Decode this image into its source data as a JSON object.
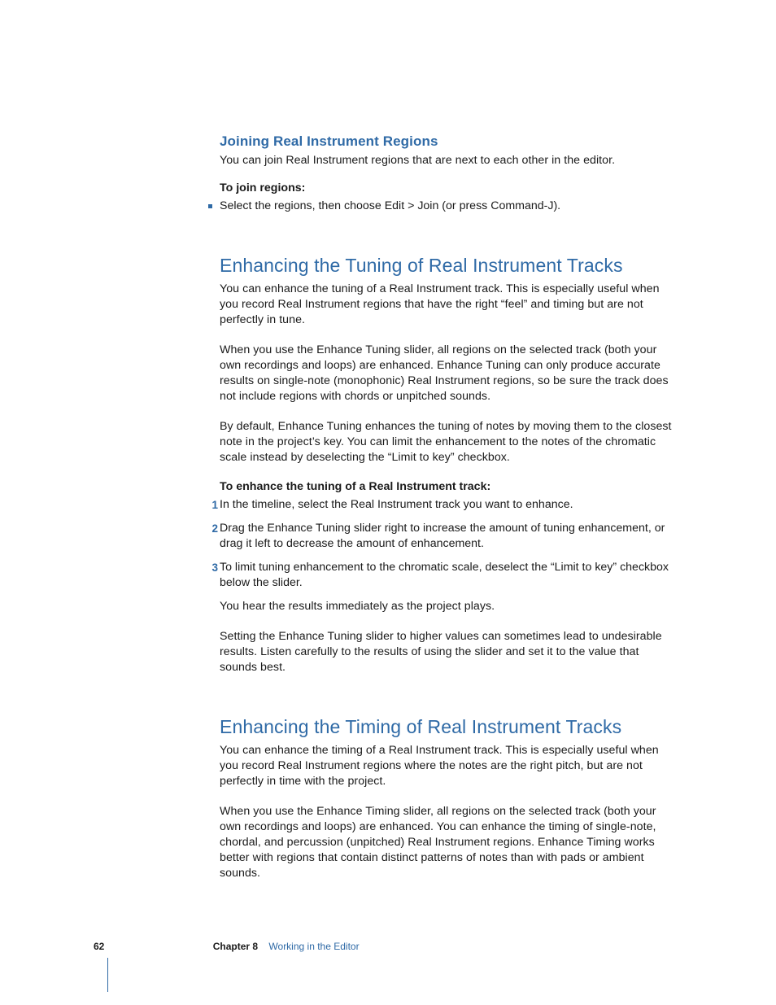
{
  "s1": {
    "h": "Joining Real Instrument Regions",
    "p1": "You can join Real Instrument regions that are next to each other in the editor.",
    "lead": "To join regions:",
    "b1": "Select the regions, then choose Edit > Join (or press Command-J)."
  },
  "s2": {
    "h": "Enhancing the Tuning of Real Instrument Tracks",
    "p1": "You can enhance the tuning of a Real Instrument track. This is especially useful when you record Real Instrument regions that have the right “feel” and timing but are not perfectly in tune.",
    "p2": "When you use the Enhance Tuning slider, all regions on the selected track (both your own recordings and loops) are enhanced. Enhance Tuning can only produce accurate results on single-note (monophonic) Real Instrument regions, so be sure the track does not include regions with chords or unpitched sounds.",
    "p3": "By default, Enhance Tuning enhances the tuning of notes by moving them to the closest note in the project’s key. You can limit the enhancement to the notes of the chromatic scale instead by deselecting the “Limit to key” checkbox.",
    "lead": "To enhance the tuning of a Real Instrument track:",
    "st1": "In the timeline, select the Real Instrument track you want to enhance.",
    "st2": "Drag the Enhance Tuning slider right to increase the amount of tuning enhancement, or drag it left to decrease the amount of enhancement.",
    "st3": "To limit tuning enhancement to the chromatic scale, deselect the “Limit to key” checkbox below the slider.",
    "p4": "You hear the results immediately as the project plays.",
    "p5": "Setting the Enhance Tuning slider to higher values can sometimes lead to undesirable results. Listen carefully to the results of using the slider and set it to the value that sounds best."
  },
  "s3": {
    "h": "Enhancing the Timing of Real Instrument Tracks",
    "p1": "You can enhance the timing of a Real Instrument track. This is especially useful when you record Real Instrument regions where the notes are the right pitch, but are not perfectly in time with the project.",
    "p2": "When you use the Enhance Timing slider, all regions on the selected track (both your own recordings and loops) are enhanced. You can enhance the timing of single-note, chordal, and percussion (unpitched) Real Instrument regions. Enhance Timing works better with regions that contain distinct patterns of notes than with pads or ambient sounds."
  },
  "nums": {
    "n1": "1",
    "n2": "2",
    "n3": "3"
  },
  "footer": {
    "page": "62",
    "chapter": "Chapter 8",
    "title": "Working in the Editor"
  }
}
